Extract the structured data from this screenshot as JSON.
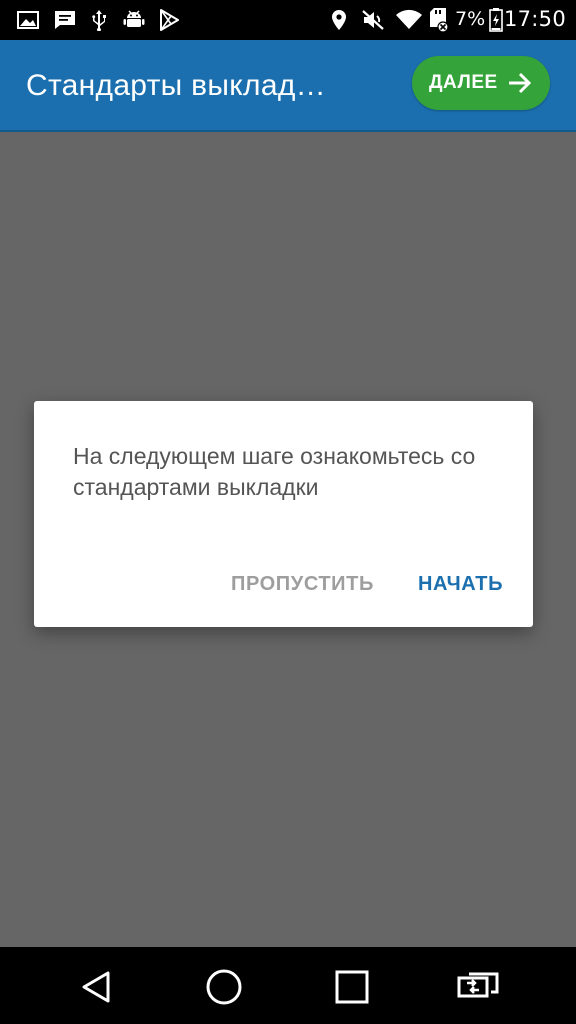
{
  "status_bar": {
    "icons_left": [
      "image-icon",
      "message-icon",
      "usb-icon",
      "android-debug-icon",
      "play-store-icon"
    ],
    "icons_right": [
      "location-icon",
      "mute-icon",
      "wifi-icon",
      "sd-card-icon"
    ],
    "battery_percent": "7%",
    "time": "17:50",
    "colors": {
      "background": "#000000",
      "foreground": "#ffffff"
    }
  },
  "app_bar": {
    "title": "Стандарты выклад…",
    "next_button": {
      "label": "ДАЛЕЕ",
      "icon": "arrow-right-icon"
    },
    "colors": {
      "background": "#1b6fae",
      "button": "#34a33a"
    }
  },
  "dialog": {
    "message": "На следующем шаге ознакомьтесь со стандартами выкладки",
    "buttons": {
      "skip": "ПРОПУСТИТЬ",
      "start": "НАЧАТЬ"
    },
    "colors": {
      "skip": "#9e9e9e",
      "start": "#1b6fae"
    }
  },
  "nav_bar": {
    "buttons": [
      "back-icon",
      "home-icon",
      "recents-icon",
      "switch-app-icon"
    ]
  }
}
